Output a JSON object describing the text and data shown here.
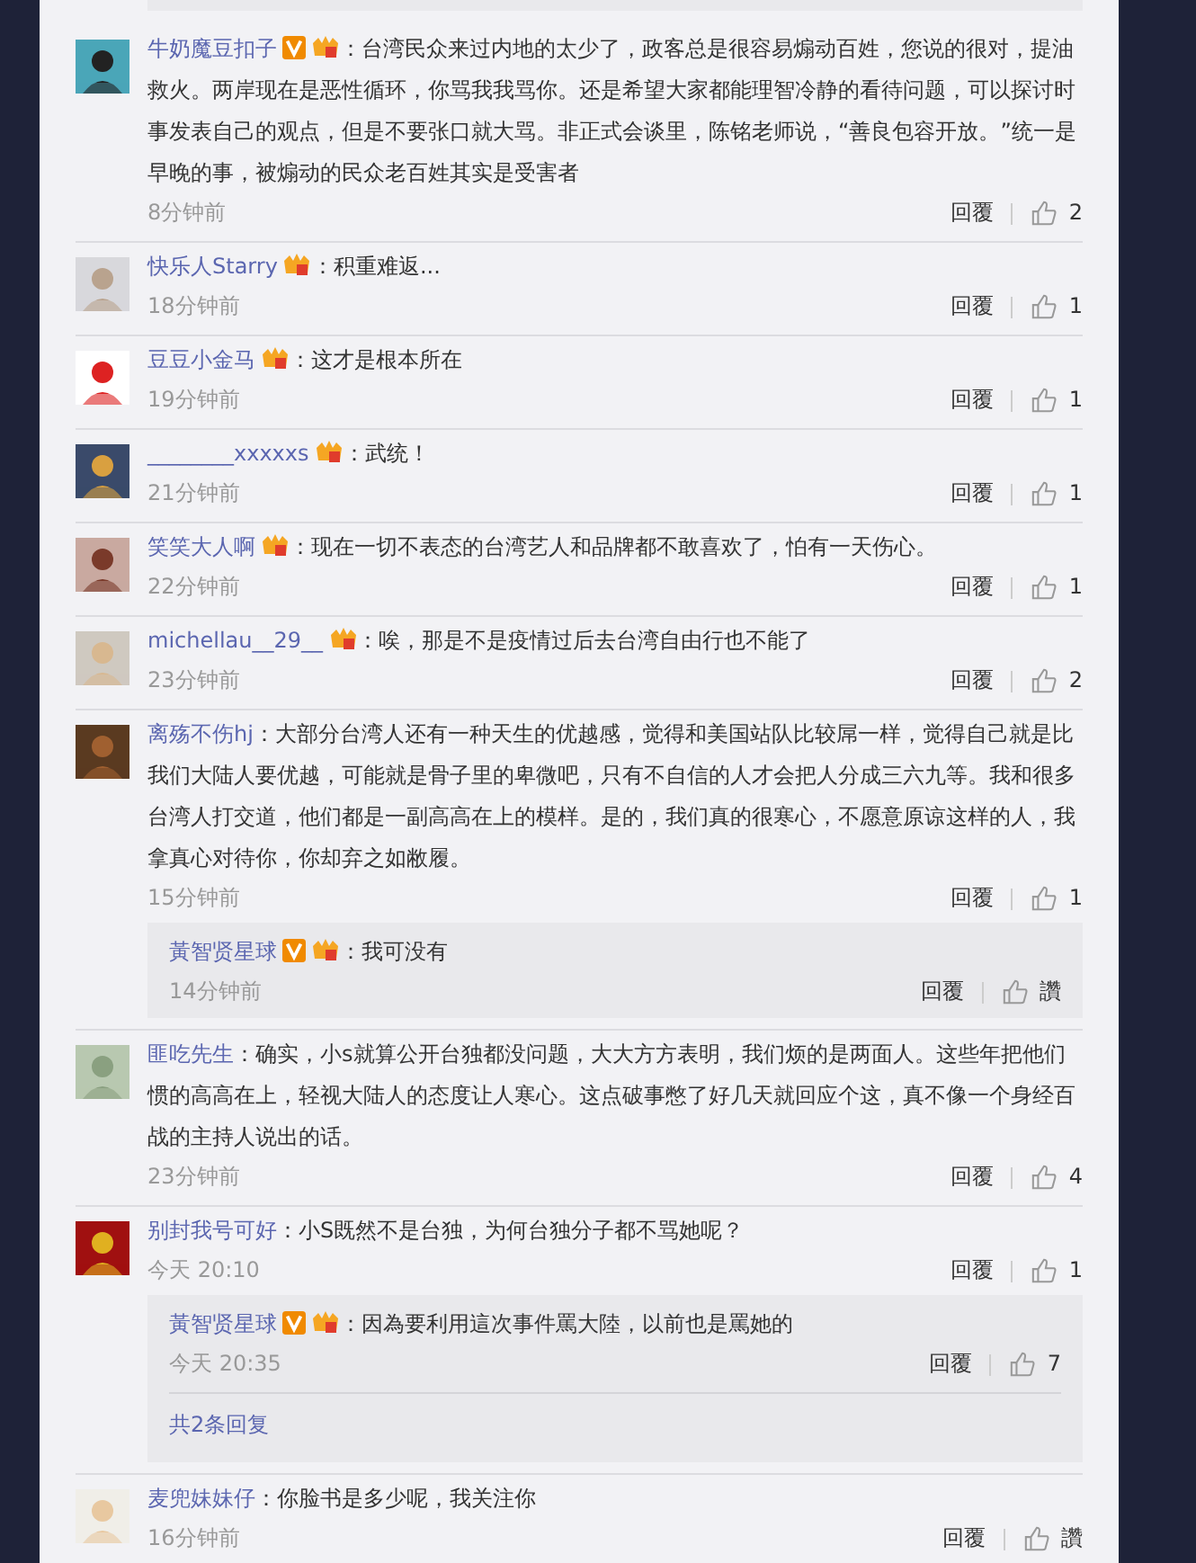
{
  "comments": [
    {
      "name": "牛奶魔豆扣子",
      "verified": true,
      "vip": true,
      "text": "：台湾民众来过内地的太少了，政客总是很容易煽动百姓，您说的很对，提油救火。两岸现在是恶性循环，你骂我我骂你。还是希望大家都能理智冷静的看待问题，可以探讨时事发表自己的观点，但是不要张口就大骂。非正式会谈里，陈铭老师说，“善良包容开放。”统一是早晚的事，被煽动的民众老百姓其实是受害者",
      "time": "8分钟前",
      "reply": "回覆",
      "likes": "2"
    },
    {
      "name": "快乐人Starry",
      "verified": false,
      "vip": true,
      "text": "：积重难返...",
      "time": "18分钟前",
      "reply": "回覆",
      "likes": "1"
    },
    {
      "name": "豆豆小金马",
      "verified": false,
      "vip": true,
      "text": "：这才是根本所在",
      "time": "19分钟前",
      "reply": "回覆",
      "likes": "1"
    },
    {
      "name": "________xxxxxs",
      "verified": false,
      "vip": true,
      "text": "：武统！",
      "time": "21分钟前",
      "reply": "回覆",
      "likes": "1"
    },
    {
      "name": "笑笑大人啊",
      "verified": false,
      "vip": true,
      "text": "：现在一切不表态的台湾艺人和品牌都不敢喜欢了，怕有一天伤心。",
      "time": "22分钟前",
      "reply": "回覆",
      "likes": "1"
    },
    {
      "name": "michellau__29__",
      "verified": false,
      "vip": true,
      "text": "：唉，那是不是疫情过后去台湾自由行也不能了",
      "time": "23分钟前",
      "reply": "回覆",
      "likes": "2"
    },
    {
      "name": "离殇不伤hj",
      "verified": false,
      "vip": false,
      "text": "：大部分台湾人还有一种天生的优越感，觉得和美国站队比较屌一样，觉得自己就是比我们大陆人要优越，可能就是骨子里的卑微吧，只有不自信的人才会把人分成三六九等。我和很多台湾人打交道，他们都是一副高高在上的模样。是的，我们真的很寒心，不愿意原谅这样的人，我拿真心对待你，你却弃之如敝履。",
      "time": "15分钟前",
      "reply": "回覆",
      "likes": "1",
      "replies": [
        {
          "name": "黃智贤星球",
          "verified": true,
          "vip": true,
          "text": "：我可没有",
          "time": "14分钟前",
          "reply": "回覆",
          "likes": "讚"
        }
      ]
    },
    {
      "name": "匪吃先生",
      "verified": false,
      "vip": false,
      "text": "：确实，小s就算公开台独都没问题，大大方方表明，我们烦的是两面人。这些年把他们惯的高高在上，轻视大陆人的态度让人寒心。这点破事憋了好几天就回应个这，真不像一个身经百战的主持人说出的话。",
      "time": "23分钟前",
      "reply": "回覆",
      "likes": "4"
    },
    {
      "name": "别封我号可好",
      "verified": false,
      "vip": false,
      "text": "：小S既然不是台独，为何台独分子都不骂她呢？",
      "time": "今天 20:10",
      "reply": "回覆",
      "likes": "1",
      "replies": [
        {
          "name": "黃智贤星球",
          "verified": true,
          "vip": true,
          "text": "：因為要利用這次事件罵大陸，以前也是罵她的",
          "time": "今天 20:35",
          "reply": "回覆",
          "likes": "7"
        }
      ],
      "more": "共2条回复"
    },
    {
      "name": "麦兜妹妹仔",
      "verified": false,
      "vip": false,
      "text": "：你脸书是多少呢，我关注你",
      "time": "16分钟前",
      "reply": "回覆",
      "likes": "讚"
    }
  ]
}
